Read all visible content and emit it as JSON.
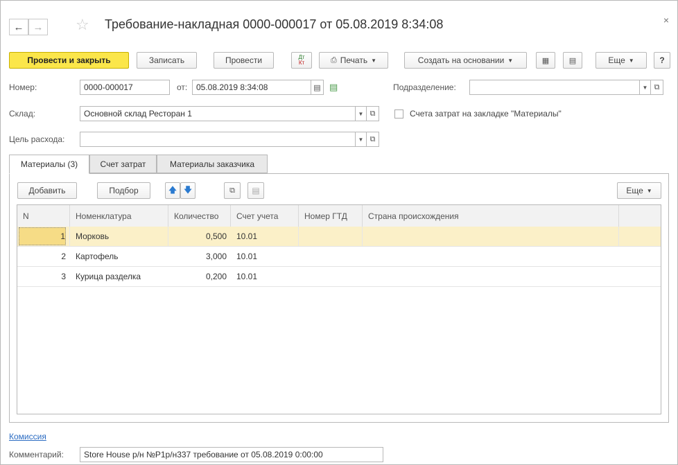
{
  "window": {
    "title": "Требование-накладная 0000-000017 от 05.08.2019 8:34:08",
    "close_glyph": "×"
  },
  "toolbar": {
    "post_close": "Провести и закрыть",
    "save": "Записать",
    "post": "Провести",
    "dtkt_top": "Дт",
    "dtkt_bottom": "Кт",
    "print": "Печать",
    "create_based": "Создать на основании",
    "more": "Еще",
    "help": "?"
  },
  "form": {
    "number_label": "Номер:",
    "number_value": "0000-000017",
    "date_label": "от:",
    "date_value": "05.08.2019  8:34:08",
    "division_label": "Подразделение:",
    "division_value": "",
    "warehouse_label": "Склад:",
    "warehouse_value": "Основной склад Ресторан 1",
    "cost_checkbox_label": "Счета затрат на закладке \"Материалы\"",
    "purpose_label": "Цель расхода:",
    "purpose_value": ""
  },
  "tabs": [
    {
      "label": "Материалы (3)"
    },
    {
      "label": "Счет затрат"
    },
    {
      "label": "Материалы заказчика"
    }
  ],
  "table_toolbar": {
    "add": "Добавить",
    "pick": "Подбор",
    "more": "Еще"
  },
  "table": {
    "columns": [
      "N",
      "Номенклатура",
      "Количество",
      "Счет учета",
      "Номер ГТД",
      "Страна происхождения"
    ],
    "rows": [
      {
        "n": "1",
        "name": "Морковь",
        "qty": "0,500",
        "account": "10.01",
        "gtd": "",
        "country": ""
      },
      {
        "n": "2",
        "name": "Картофель",
        "qty": "3,000",
        "account": "10.01",
        "gtd": "",
        "country": ""
      },
      {
        "n": "3",
        "name": "Курица разделка",
        "qty": "0,200",
        "account": "10.01",
        "gtd": "",
        "country": ""
      }
    ]
  },
  "footer": {
    "commission_link": "Комиссия",
    "comment_label": "Комментарий:",
    "comment_value": "Store House р/н №Р1р/н337 требование от 05.08.2019 0:00:00"
  },
  "colors": {
    "primary_button": "#fbe64a",
    "selected_row": "#fbf0c8",
    "link": "#2a6bc2"
  }
}
